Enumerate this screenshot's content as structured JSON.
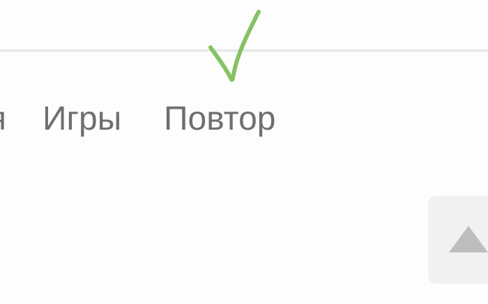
{
  "tabs": [
    {
      "label": "я"
    },
    {
      "label": "Игры"
    },
    {
      "label": "Повтор"
    }
  ],
  "annotation": {
    "icon": "checkmark-icon",
    "color": "#86c265"
  },
  "scroll_top": {
    "icon": "chevron-up-icon",
    "color": "#bdbdbd",
    "background": "#f1f1f1"
  }
}
